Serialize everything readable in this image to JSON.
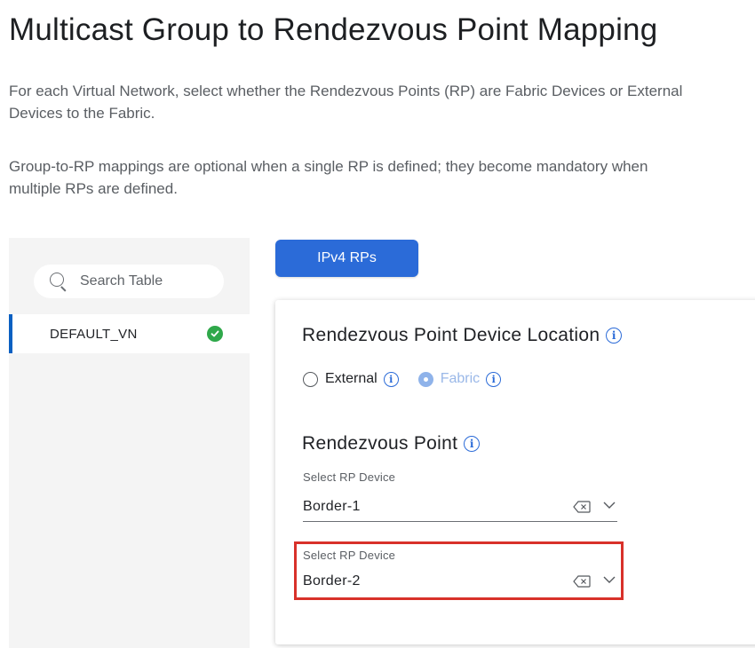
{
  "page": {
    "title": "Multicast Group to Rendezvous Point Mapping",
    "description1": "For each Virtual Network, select whether the Rendezvous Points (RP) are Fabric Devices or External Devices to the Fabric.",
    "description2": "Group-to-RP mappings are optional when a single RP is defined; they become mandatory when multiple RPs are defined."
  },
  "table": {
    "search_placeholder": "Search Table",
    "rows": [
      {
        "label": "DEFAULT_VN",
        "status": "check-circle-icon",
        "status_color": "#2fa84a",
        "selected": true
      }
    ]
  },
  "tabs": {
    "ipv4_label": "IPv4 RPs",
    "accent_color": "#2b6bd8"
  },
  "card": {
    "location_title": "Rendezvous Point Device Location",
    "radio_external": "External",
    "radio_fabric": "Fabric",
    "selected_option": "Fabric",
    "rp_title": "Rendezvous Point",
    "fields": [
      {
        "label": "Select RP Device",
        "value": "Border-1"
      },
      {
        "label": "Select RP Device",
        "value": "Border-2",
        "highlighted": true,
        "highlight_color": "#d8312a"
      }
    ]
  }
}
